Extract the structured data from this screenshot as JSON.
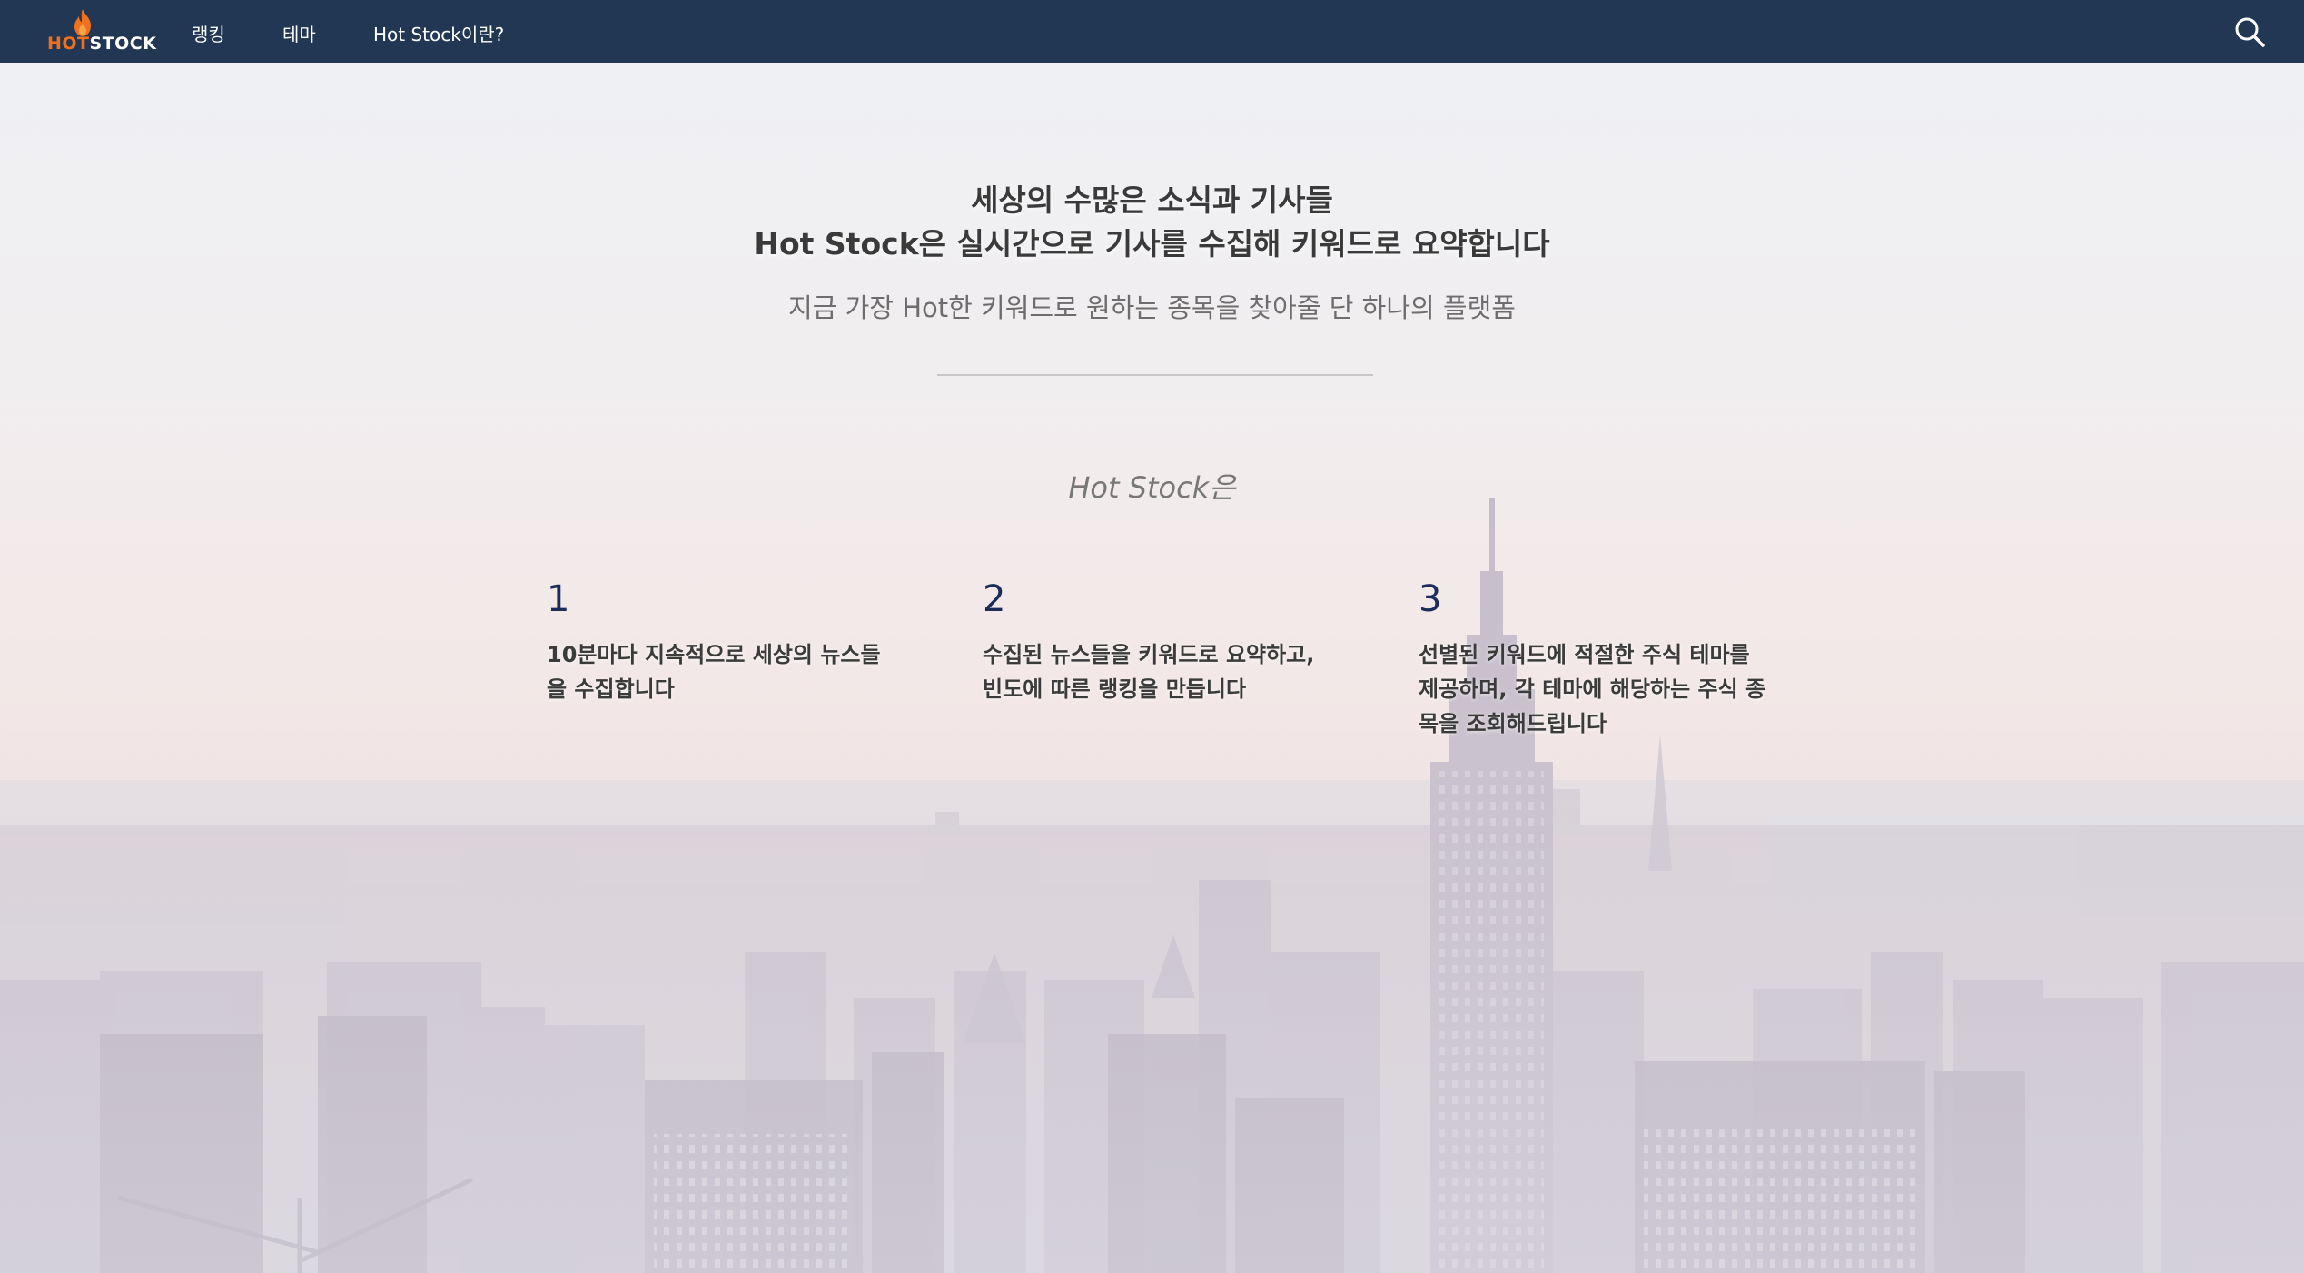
{
  "navbar": {
    "logo_hot": "HOT",
    "logo_stock": "STOCK",
    "links": [
      {
        "label": "랭킹"
      },
      {
        "label": "테마"
      },
      {
        "label": "Hot Stock이란?"
      }
    ],
    "search_icon": "search-icon"
  },
  "hero": {
    "headline_line1": "세상의 수많은 소식과 기사들",
    "headline_line2": "Hot Stock은 실시간으로 기사를 수집해 키워드로 요약합니다",
    "subtitle": "지금 가장 Hot한 키워드로 원하는 종목을 찾아줄 단 하나의 플랫폼"
  },
  "about": {
    "title": "Hot Stock은",
    "features": [
      {
        "number": "1",
        "text": "10분마다 지속적으로 세상의 뉴스들을 수집합니다"
      },
      {
        "number": "2",
        "text": "수집된 뉴스들을 키워드로 요약하고, 빈도에 따른 랭킹을 만듭니다"
      },
      {
        "number": "3",
        "text": "선별된 키워드에 적절한 주식 테마를 제공하며, 각 테마에 해당하는 주식 종목을 조회해드립니다"
      }
    ]
  },
  "colors": {
    "navbar_bg": "#223754",
    "logo_hot": "#f0711d",
    "feature_number": "#1c2c5a"
  }
}
